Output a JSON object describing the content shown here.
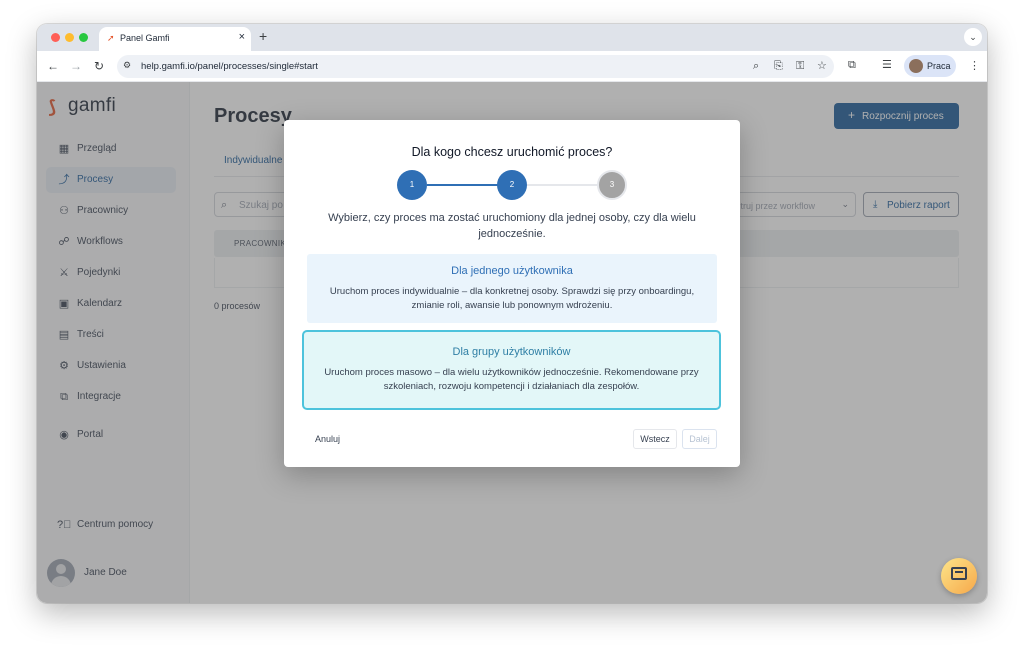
{
  "browser": {
    "tab_title": "Panel Gamfi",
    "tab_favicon": "gamfi-favicon",
    "tab_close": "×",
    "new_tab": "+",
    "tab_menu": "⌄",
    "url": "help.gamfi.io/panel/processes/single#start",
    "profile_name": "Praca"
  },
  "sidebar": {
    "logo_text": "gamfi",
    "items": [
      {
        "label": "Przegląd",
        "icon": "grid-icon",
        "glyph": "▦",
        "active": false
      },
      {
        "label": "Procesy",
        "icon": "process-icon",
        "glyph": "⤴",
        "active": true
      },
      {
        "label": "Pracownicy",
        "icon": "users-icon",
        "glyph": "👥",
        "active": false
      },
      {
        "label": "Workflows",
        "icon": "workflow-icon",
        "glyph": "☍",
        "active": false
      },
      {
        "label": "Pojedynki",
        "icon": "swords-icon",
        "glyph": "⚔",
        "active": false
      },
      {
        "label": "Kalendarz",
        "icon": "calendar-icon",
        "glyph": "▣",
        "active": false
      },
      {
        "label": "Treści",
        "icon": "clipboard-icon",
        "glyph": "▤",
        "active": false
      },
      {
        "label": "Ustawienia",
        "icon": "gear-icon",
        "glyph": "⚙",
        "active": false
      },
      {
        "label": "Integracje",
        "icon": "puzzle-icon",
        "glyph": "⧉",
        "active": false
      },
      {
        "label": "Portal",
        "icon": "portal-icon",
        "glyph": "◉",
        "active": false
      }
    ],
    "help_label": "Centrum pomocy",
    "user_name": "Jane Doe"
  },
  "main": {
    "title": "Procesy",
    "start_button": "Rozpocznij proces",
    "tab_individual": "Indywidualne",
    "search_placeholder": "Szukaj po",
    "workflow_filter": "Filtruj przez workflow",
    "report_button": "Pobierz raport",
    "table_header": "PRACOWNIK",
    "count": "0 procesów"
  },
  "modal": {
    "title": "Dla kogo chcesz uruchomić proces?",
    "steps": [
      "1",
      "2",
      "3"
    ],
    "current_step": 2,
    "description": "Wybierz, czy proces ma zostać uruchomiony dla jednej osoby, czy dla wielu jednocześnie.",
    "option_single": {
      "title": "Dla jednego użytkownika",
      "description": "Uruchom proces indywidualnie – dla konkretnej osoby. Sprawdzi się przy onboardingu, zmianie roli, awansie lub ponownym wdrożeniu."
    },
    "option_group": {
      "title": "Dla grupy użytkowników",
      "description": "Uruchom proces masowo – dla wielu użytkowników jednocześnie. Rekomendowane przy szkoleniach, rozwoju kompetencji i działaniach dla zespołów."
    },
    "cancel": "Anuluj",
    "back": "Wstecz",
    "next": "Dalej"
  },
  "colors": {
    "accent": "#1d5c99",
    "step_active": "#2f6fb5",
    "step_inactive": "#a3a3a3",
    "option_selected_border": "#4dc3dc",
    "brand_orange": "#e4572e"
  }
}
